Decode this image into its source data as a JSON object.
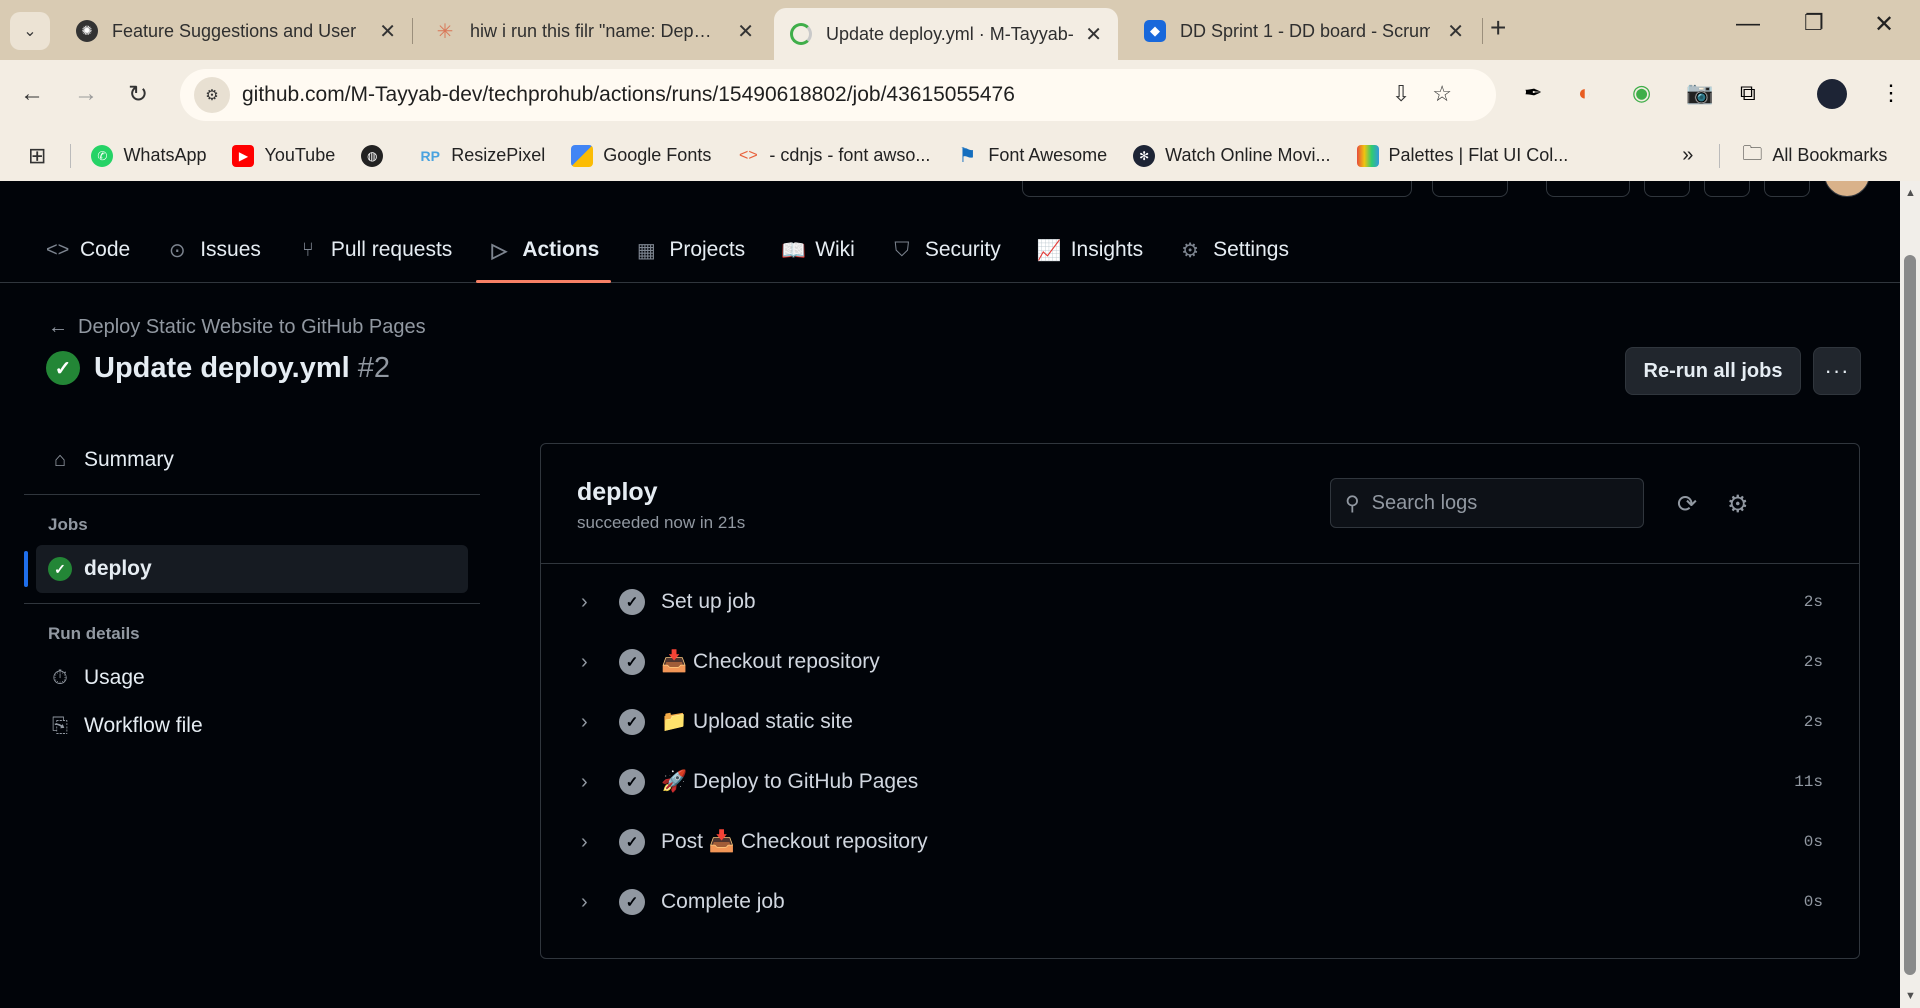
{
  "browser": {
    "tabs": [
      {
        "title": "Feature Suggestions and User S",
        "favicon": "openai-icon",
        "active": false
      },
      {
        "title": "hiw i run this filr \"name: Dep…",
        "favicon": "claude-icon",
        "active": false
      },
      {
        "title": "Update deploy.yml · M-Tayyab-",
        "favicon": "github-loading-icon",
        "active": true
      },
      {
        "title": "DD Sprint 1 - DD board - Scrum",
        "favicon": "jira-icon",
        "active": false
      }
    ],
    "url": "github.com/M-Tayyab-dev/techprohub/actions/runs/15490618802/job/43615055476",
    "bookmarks": [
      {
        "label": "WhatsApp",
        "icon": "whatsapp-icon",
        "color": "#25d366"
      },
      {
        "label": "YouTube",
        "icon": "youtube-icon",
        "color": "#ff0000"
      },
      {
        "label": "",
        "icon": "globe-icon",
        "color": "#222222"
      },
      {
        "label": "ResizePixel",
        "icon": "resizepixel-icon",
        "color": "#4aa3df"
      },
      {
        "label": "Google Fonts",
        "icon": "google-fonts-icon",
        "color": "#4285f4"
      },
      {
        "label": "- cdnjs - font awso...",
        "icon": "cdnjs-icon",
        "color": "#e8613c"
      },
      {
        "label": "Font Awesome",
        "icon": "font-awesome-icon",
        "color": "#146ebe"
      },
      {
        "label": "Watch Online Movi...",
        "icon": "movie-reel-icon",
        "color": "#1d2435"
      },
      {
        "label": "Palettes | Flat UI Col...",
        "icon": "flat-ui-icon",
        "color": "#e74c3c"
      }
    ],
    "all_bookmarks": "All Bookmarks"
  },
  "repo_nav": [
    {
      "label": "Code",
      "icon": "code-icon",
      "glyph": "<>",
      "selected": false
    },
    {
      "label": "Issues",
      "icon": "issue-icon",
      "glyph": "⊙",
      "selected": false
    },
    {
      "label": "Pull requests",
      "icon": "pull-request-icon",
      "glyph": "⑂",
      "selected": false
    },
    {
      "label": "Actions",
      "icon": "play-icon",
      "glyph": "▷",
      "selected": true
    },
    {
      "label": "Projects",
      "icon": "table-icon",
      "glyph": "▦",
      "selected": false
    },
    {
      "label": "Wiki",
      "icon": "book-icon",
      "glyph": "📖",
      "selected": false
    },
    {
      "label": "Security",
      "icon": "shield-icon",
      "glyph": "⛉",
      "selected": false
    },
    {
      "label": "Insights",
      "icon": "graph-icon",
      "glyph": "📈",
      "selected": false
    },
    {
      "label": "Settings",
      "icon": "gear-icon",
      "glyph": "⚙",
      "selected": false
    }
  ],
  "run": {
    "back_link": "Deploy Static Website to GitHub Pages",
    "title": "Update deploy.yml",
    "number": "#2",
    "rerun_label": "Re-run all jobs"
  },
  "sidebar": {
    "summary": "Summary",
    "jobs_heading": "Jobs",
    "job": "deploy",
    "run_details_heading": "Run details",
    "usage": "Usage",
    "workflow_file": "Workflow file"
  },
  "log": {
    "job_name": "deploy",
    "status": "succeeded now in 21s",
    "search_placeholder": "Search logs",
    "steps": [
      {
        "name": "Set up job",
        "time": "2s"
      },
      {
        "name": "📥 Checkout repository",
        "time": "2s"
      },
      {
        "name": "📁 Upload static site",
        "time": "2s"
      },
      {
        "name": "🚀 Deploy to GitHub Pages",
        "time": "11s"
      },
      {
        "name": "Post 📥 Checkout repository",
        "time": "0s"
      },
      {
        "name": "Complete job",
        "time": "0s"
      }
    ]
  },
  "colors": {
    "success": "#238636",
    "tab_underline": "#f78166",
    "selected_job_bar": "#1f6feb"
  }
}
